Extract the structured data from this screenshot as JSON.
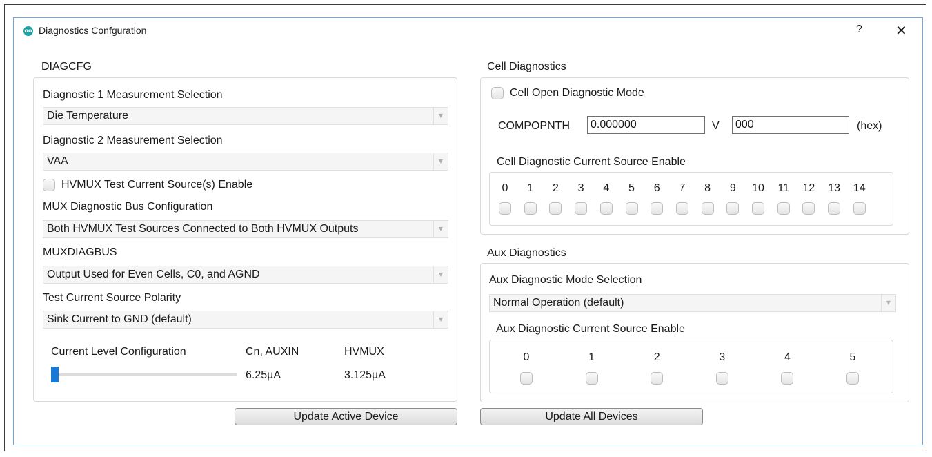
{
  "window": {
    "title": "Diagnostics Confguration",
    "app_icon_text": "oo",
    "help_label": "?",
    "close_label": "✕"
  },
  "diagcfg": {
    "label": "DIAGCFG",
    "diag1_label": "Diagnostic 1 Measurement Selection",
    "diag1_value": "Die Temperature",
    "diag2_label": "Diagnostic 2 Measurement Selection",
    "diag2_value": "VAA",
    "hvmux_enable_label": "HVMUX Test Current Source(s) Enable",
    "hvmux_enable_checked": false,
    "mux_bus_label": "MUX Diagnostic Bus Configuration",
    "mux_bus_value": "Both HVMUX Test Sources Connected to Both HVMUX Outputs",
    "muxdiagbus_label": "MUXDIAGBUS",
    "muxdiagbus_value": "Output Used for Even Cells, C0, and AGND",
    "polarity_label": "Test Current Source Polarity",
    "polarity_value": "Sink Current to GND (default)",
    "current_level_label": "Current Level Configuration",
    "current_level_position": 0,
    "cn_auxin_header": "Cn, AUXIN",
    "hvmux_header": "HVMUX",
    "cn_auxin_value": "6.25µA",
    "hvmux_value": "3.125µA"
  },
  "cell": {
    "label": "Cell Diagnostics",
    "open_mode_label": "Cell Open Diagnostic Mode",
    "open_mode_checked": false,
    "compopnth_label": "COMPOPNTH",
    "compopnth_value": "0.000000",
    "unit_v": "V",
    "hex_value": "000",
    "hex_label": "(hex)",
    "current_source_label": "Cell Diagnostic Current Source Enable",
    "channels": [
      "0",
      "1",
      "2",
      "3",
      "4",
      "5",
      "6",
      "7",
      "8",
      "9",
      "10",
      "11",
      "12",
      "13",
      "14"
    ]
  },
  "aux": {
    "label": "Aux Diagnostics",
    "mode_label": "Aux Diagnostic Mode Selection",
    "mode_value": "Normal Operation (default)",
    "current_source_label": "Aux Diagnostic Current Source Enable",
    "channels": [
      "0",
      "1",
      "2",
      "3",
      "4",
      "5"
    ]
  },
  "buttons": {
    "update_active": "Update Active Device",
    "update_all": "Update All Devices"
  },
  "colors": {
    "dialog_border": "#6fa8dc",
    "slider_thumb": "#1878d8",
    "app_icon": "#1aa3a3"
  }
}
